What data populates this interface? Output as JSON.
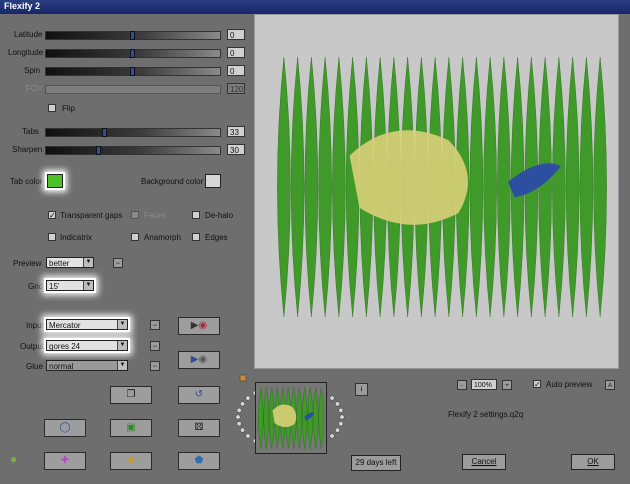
{
  "window": {
    "title": "Flexify 2"
  },
  "sliders": {
    "latitude": {
      "label": "Latitude",
      "value": "0"
    },
    "longitude": {
      "label": "Longitude",
      "value": "0"
    },
    "spin": {
      "label": "Spin",
      "value": "0"
    },
    "fov": {
      "label": "FOV",
      "value": "120"
    },
    "tabs": {
      "label": "Tabs",
      "value": "33"
    },
    "sharpen": {
      "label": "Sharpen",
      "value": "30"
    }
  },
  "flip": {
    "label": "Flip"
  },
  "colors": {
    "tab_label": "Tab color",
    "tab_color": "#4ec02a",
    "background_label": "Background color",
    "background_color": "#d6d6d6"
  },
  "checkboxes": {
    "transparent_gaps": {
      "label": "Transparent gaps",
      "checked": "✓"
    },
    "faces": {
      "label": "Faces"
    },
    "dehalo": {
      "label": "De-halo"
    },
    "indicatrix": {
      "label": "Indicatrix"
    },
    "anamorph": {
      "label": "Anamorph"
    },
    "edges": {
      "label": "Edges"
    }
  },
  "preview_quality": {
    "label": "Preview",
    "value": "better"
  },
  "grid": {
    "label": "Grid",
    "value": "15'"
  },
  "input": {
    "label": "Input",
    "value": "Mercator"
  },
  "output": {
    "label": "Output",
    "value": "gores 24"
  },
  "glue": {
    "label": "Glue",
    "value": "normal"
  },
  "zoom": {
    "minus": "-",
    "value": "100%",
    "plus": "+"
  },
  "auto_preview": {
    "label": "Auto preview",
    "checked": "✓",
    "help": "A"
  },
  "settings_file": "Flexify 2 settings.q2q",
  "trial": "29 days left",
  "buttons": {
    "cancel": "Cancel",
    "ok": "OK",
    "info": "i"
  },
  "icons": {
    "link": "∽"
  }
}
